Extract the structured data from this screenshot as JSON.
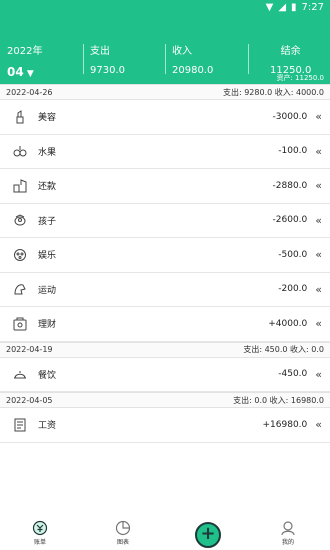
{
  "status": {
    "time": "7:27"
  },
  "header": {
    "year": "2022年",
    "month": "04",
    "expense_label": "支出",
    "expense_value": "9730.0",
    "income_label": "收入",
    "income_value": "20980.0",
    "balance_label": "结余",
    "balance_value": "11250.0",
    "assets": "资产: 11250.0"
  },
  "groups": [
    {
      "date": "2022-04-26",
      "summary": "支出: 9280.0 收入: 4000.0",
      "rows": [
        {
          "icon": "lipstick-icon",
          "name": "美容",
          "amount": "-3000.0"
        },
        {
          "icon": "fruit-icon",
          "name": "水果",
          "amount": "-100.0"
        },
        {
          "icon": "repay-icon",
          "name": "还款",
          "amount": "-2880.0"
        },
        {
          "icon": "child-icon",
          "name": "孩子",
          "amount": "-2600.0"
        },
        {
          "icon": "entertainment-icon",
          "name": "娱乐",
          "amount": "-500.0"
        },
        {
          "icon": "sport-icon",
          "name": "运动",
          "amount": "-200.0"
        },
        {
          "icon": "finance-icon",
          "name": "理财",
          "amount": "+4000.0"
        }
      ]
    },
    {
      "date": "2022-04-19",
      "summary": "支出: 450.0 收入: 0.0",
      "rows": [
        {
          "icon": "dining-icon",
          "name": "餐饮",
          "amount": "-450.0"
        }
      ]
    },
    {
      "date": "2022-04-05",
      "summary": "支出: 0.0 收入: 16980.0",
      "rows": [
        {
          "icon": "salary-icon",
          "name": "工资",
          "amount": "+16980.0"
        }
      ]
    }
  ],
  "chevron": "«",
  "tabs": {
    "bill": "账单",
    "chart": "图表",
    "add": "+",
    "mine": "我的"
  }
}
